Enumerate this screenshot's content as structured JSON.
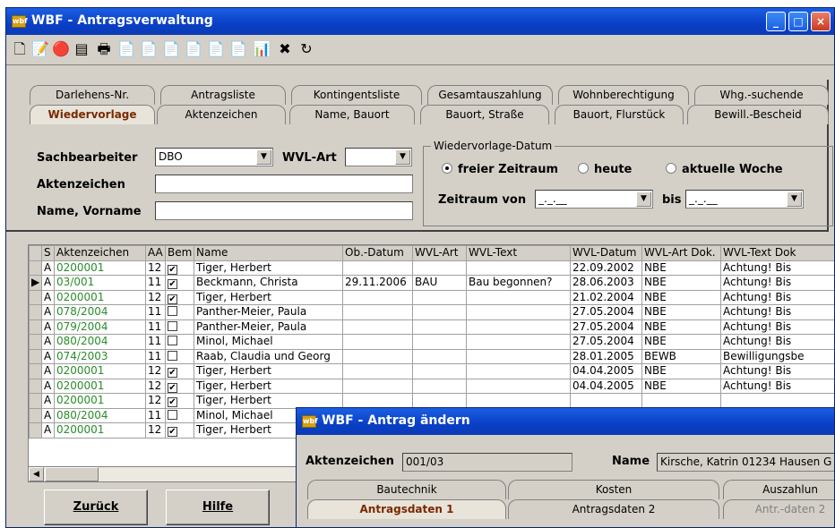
{
  "window": {
    "title": "WBF - Antragsverwaltung",
    "app_icon": "wbf"
  },
  "titlebar_buttons": {
    "minimize": "_",
    "maximize": "□",
    "close": "×"
  },
  "toolbar": [
    {
      "icon": "new-document-icon",
      "glyph": "🗋"
    },
    {
      "icon": "edit-document-icon",
      "glyph": "📝"
    },
    {
      "icon": "red-tool-icon",
      "glyph": "🔴"
    },
    {
      "icon": "form-icon",
      "glyph": "▤"
    },
    {
      "icon": "print-icon",
      "glyph": "🖶"
    },
    {
      "icon": "report-icon",
      "glyph": "📄"
    },
    {
      "icon": "report2-icon",
      "glyph": "📄"
    },
    {
      "icon": "report3-icon",
      "glyph": "📄"
    },
    {
      "icon": "report4-icon",
      "glyph": "📄"
    },
    {
      "icon": "report5-icon",
      "glyph": "📄"
    },
    {
      "icon": "report6-icon",
      "glyph": "📄"
    },
    {
      "icon": "export-icon",
      "glyph": "📊"
    },
    {
      "icon": "exit-icon",
      "glyph": "✖"
    },
    {
      "icon": "refresh-icon",
      "glyph": "↻"
    }
  ],
  "tabs_row1": [
    "Darlehens-Nr.",
    "Antragsliste",
    "Kontingentsliste",
    "Gesamtauszahlung",
    "Wohnberechtigung",
    "Whg.-suchende"
  ],
  "tabs_row2": [
    "Wiedervorlage",
    "Aktenzeichen",
    "Name, Bauort",
    "Bauort, Straße",
    "Bauort, Flurstück",
    "Bewill.-Bescheid"
  ],
  "filter": {
    "sachbearbeiter_label": "Sachbearbeiter",
    "sachbearbeiter_value": "DBO",
    "wvl_art_label": "WVL-Art",
    "wvl_art_value": "",
    "aktenzeichen_label": "Aktenzeichen",
    "aktenzeichen_value": "",
    "name_label": "Name, Vorname",
    "name_value": "",
    "group_title": "Wiedervorlage-Datum",
    "radio_freier": "freier Zeitraum",
    "radio_heute": "heute",
    "radio_woche": "aktuelle Woche",
    "zeitraum_von_label": "Zeitraum von",
    "zeitraum_von_value": "_._.__",
    "bis_label": "bis",
    "bis_value": "_._.__"
  },
  "table": {
    "headers": [
      "S",
      "Aktenzeichen",
      "AA",
      "Bem",
      "Name",
      "Ob.-Datum",
      "WVL-Art",
      "WVL-Text",
      "WVL-Datum",
      "WVL-Art Dok.",
      "WVL-Text Dok"
    ],
    "rows": [
      {
        "s": "A",
        "az": "0200001",
        "aa": "12",
        "bem": true,
        "name": "Tiger, Herbert",
        "ob": "",
        "wvlart": "",
        "wvltext": "",
        "wvldatum": "22.09.2002",
        "artdok": "NBE",
        "textdok": "Achtung!   Bis"
      },
      {
        "s": "A",
        "az": "03/001",
        "aa": "11",
        "bem": true,
        "name": "Beckmann, Christa",
        "ob": "29.11.2006",
        "wvlart": "BAU",
        "wvltext": "Bau begonnen?",
        "wvldatum": "28.06.2003",
        "artdok": "NBE",
        "textdok": "Achtung!   Bis"
      },
      {
        "s": "A",
        "az": "0200001",
        "aa": "12",
        "bem": true,
        "name": "Tiger, Herbert",
        "ob": "",
        "wvlart": "",
        "wvltext": "",
        "wvldatum": "21.02.2004",
        "artdok": "NBE",
        "textdok": "Achtung!   Bis"
      },
      {
        "s": "A",
        "az": "078/2004",
        "aa": "11",
        "bem": false,
        "name": "Panther-Meier, Paula",
        "ob": "",
        "wvlart": "",
        "wvltext": "",
        "wvldatum": "27.05.2004",
        "artdok": "NBE",
        "textdok": "Achtung!   Bis"
      },
      {
        "s": "A",
        "az": "079/2004",
        "aa": "11",
        "bem": false,
        "name": "Panther-Meier, Paula",
        "ob": "",
        "wvlart": "",
        "wvltext": "",
        "wvldatum": "27.05.2004",
        "artdok": "NBE",
        "textdok": "Achtung!   Bis"
      },
      {
        "s": "A",
        "az": "080/2004",
        "aa": "11",
        "bem": false,
        "name": "Minol, Michael",
        "ob": "",
        "wvlart": "",
        "wvltext": "",
        "wvldatum": "27.05.2004",
        "artdok": "NBE",
        "textdok": "Achtung!   Bis"
      },
      {
        "s": "A",
        "az": "074/2003",
        "aa": "11",
        "bem": false,
        "name": "Raab, Claudia und Georg",
        "ob": "",
        "wvlart": "",
        "wvltext": "",
        "wvldatum": "28.01.2005",
        "artdok": "BEWB",
        "textdok": "Bewilligungsbe"
      },
      {
        "s": "A",
        "az": "0200001",
        "aa": "12",
        "bem": true,
        "name": "Tiger, Herbert",
        "ob": "",
        "wvlart": "",
        "wvltext": "",
        "wvldatum": "04.04.2005",
        "artdok": "NBE",
        "textdok": "Achtung!   Bis"
      },
      {
        "s": "A",
        "az": "0200001",
        "aa": "12",
        "bem": true,
        "name": "Tiger, Herbert",
        "ob": "",
        "wvlart": "",
        "wvltext": "",
        "wvldatum": "04.04.2005",
        "artdok": "NBE",
        "textdok": "Achtung!   Bis"
      },
      {
        "s": "A",
        "az": "0200001",
        "aa": "12",
        "bem": true,
        "name": "Tiger, Herbert",
        "ob": "",
        "wvlart": "",
        "wvltext": "",
        "wvldatum": "",
        "artdok": "",
        "textdok": ""
      },
      {
        "s": "A",
        "az": "080/2004",
        "aa": "11",
        "bem": false,
        "name": "Minol, Michael",
        "ob": "",
        "wvlart": "",
        "wvltext": "",
        "wvldatum": "",
        "artdok": "",
        "textdok": ""
      },
      {
        "s": "A",
        "az": "0200001",
        "aa": "12",
        "bem": true,
        "name": "Tiger, Herbert",
        "ob": "",
        "wvlart": "",
        "wvltext": "",
        "wvldatum": "",
        "artdok": "",
        "textdok": ""
      }
    ],
    "selected_row": 1
  },
  "buttons": {
    "back": "Zurück",
    "help": "Hilfe"
  },
  "dialog": {
    "title": "WBF - Antrag ändern",
    "aktenzeichen_label": "Aktenzeichen",
    "aktenzeichen_value": "001/03",
    "name_label": "Name",
    "name_value": "Kirsche, Katrin  01234 Hausen  G",
    "tabs_row1": [
      "Bautechnik",
      "Kosten",
      "Auszahlun"
    ],
    "tabs_row2": [
      "Antragsdaten 1",
      "Antragsdaten 2",
      "Antr.-daten 2"
    ]
  },
  "colors": {
    "titlebar": "#0a3fc6",
    "aktenzeichen_text": "#2a8c2a",
    "active_tab_text": "#7a2a00"
  }
}
